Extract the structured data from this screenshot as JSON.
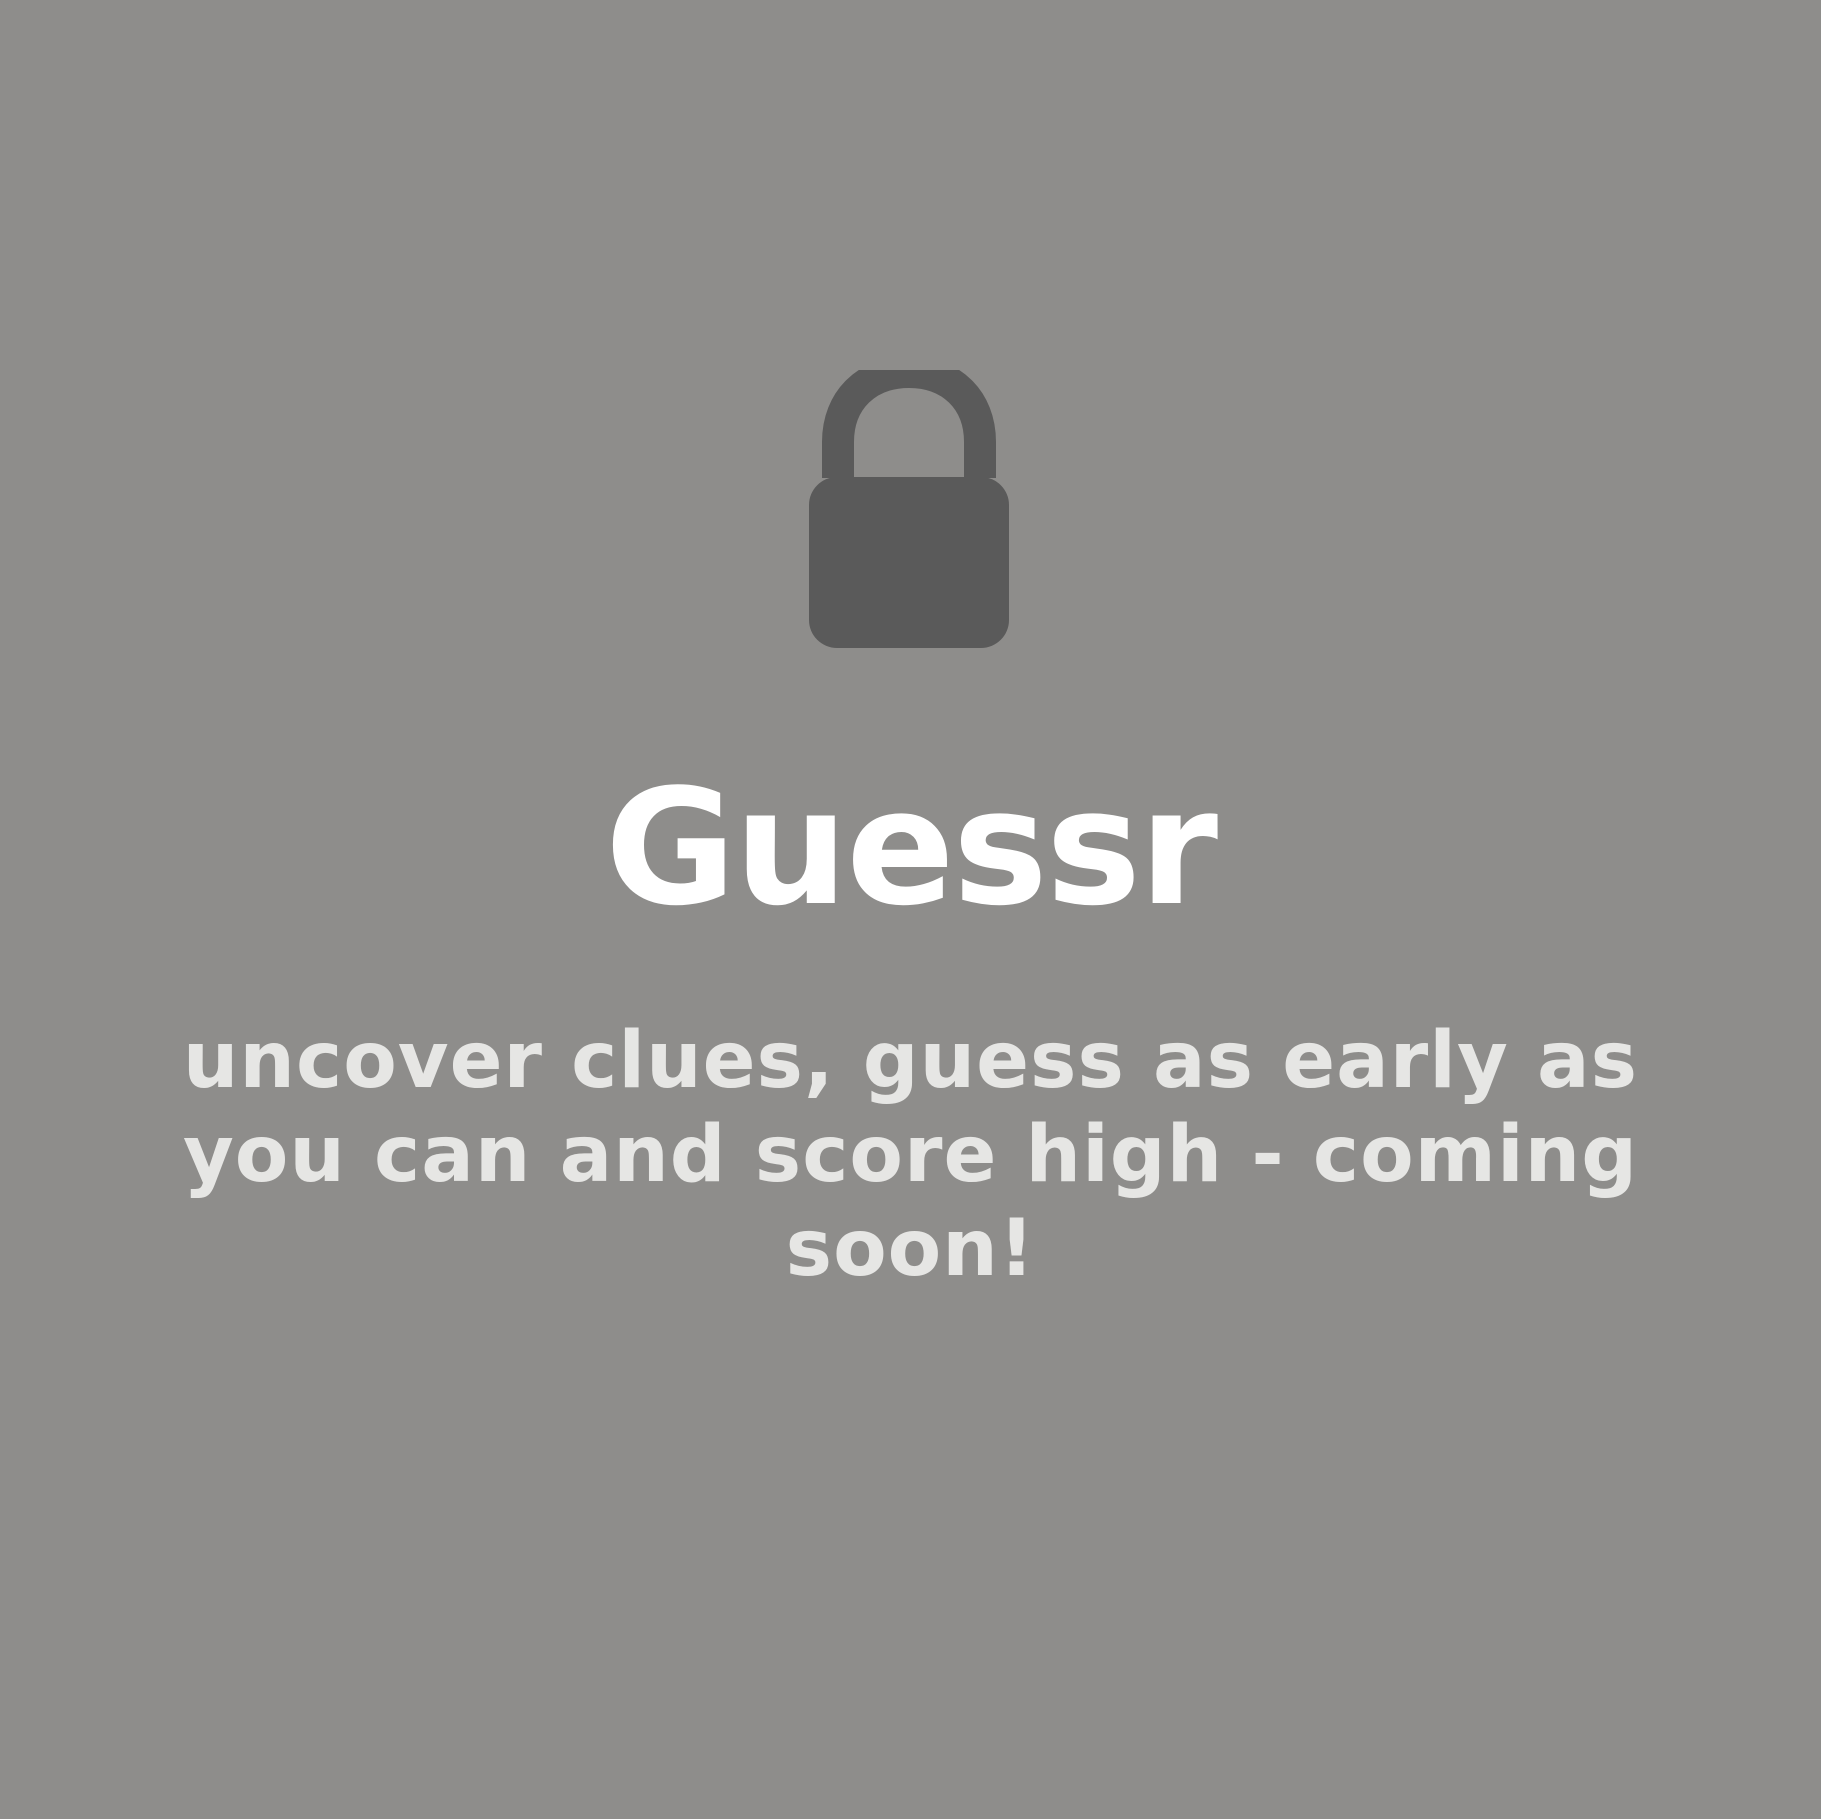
{
  "colors": {
    "background": "#8e8d8b",
    "lock": "#5a5a5a",
    "title": "#ffffff",
    "subtitle": "#e6e6e4"
  },
  "icon": "lock-icon",
  "title": "Guessr",
  "subtitle": "uncover clues, guess as early as you can and score high - coming soon!"
}
